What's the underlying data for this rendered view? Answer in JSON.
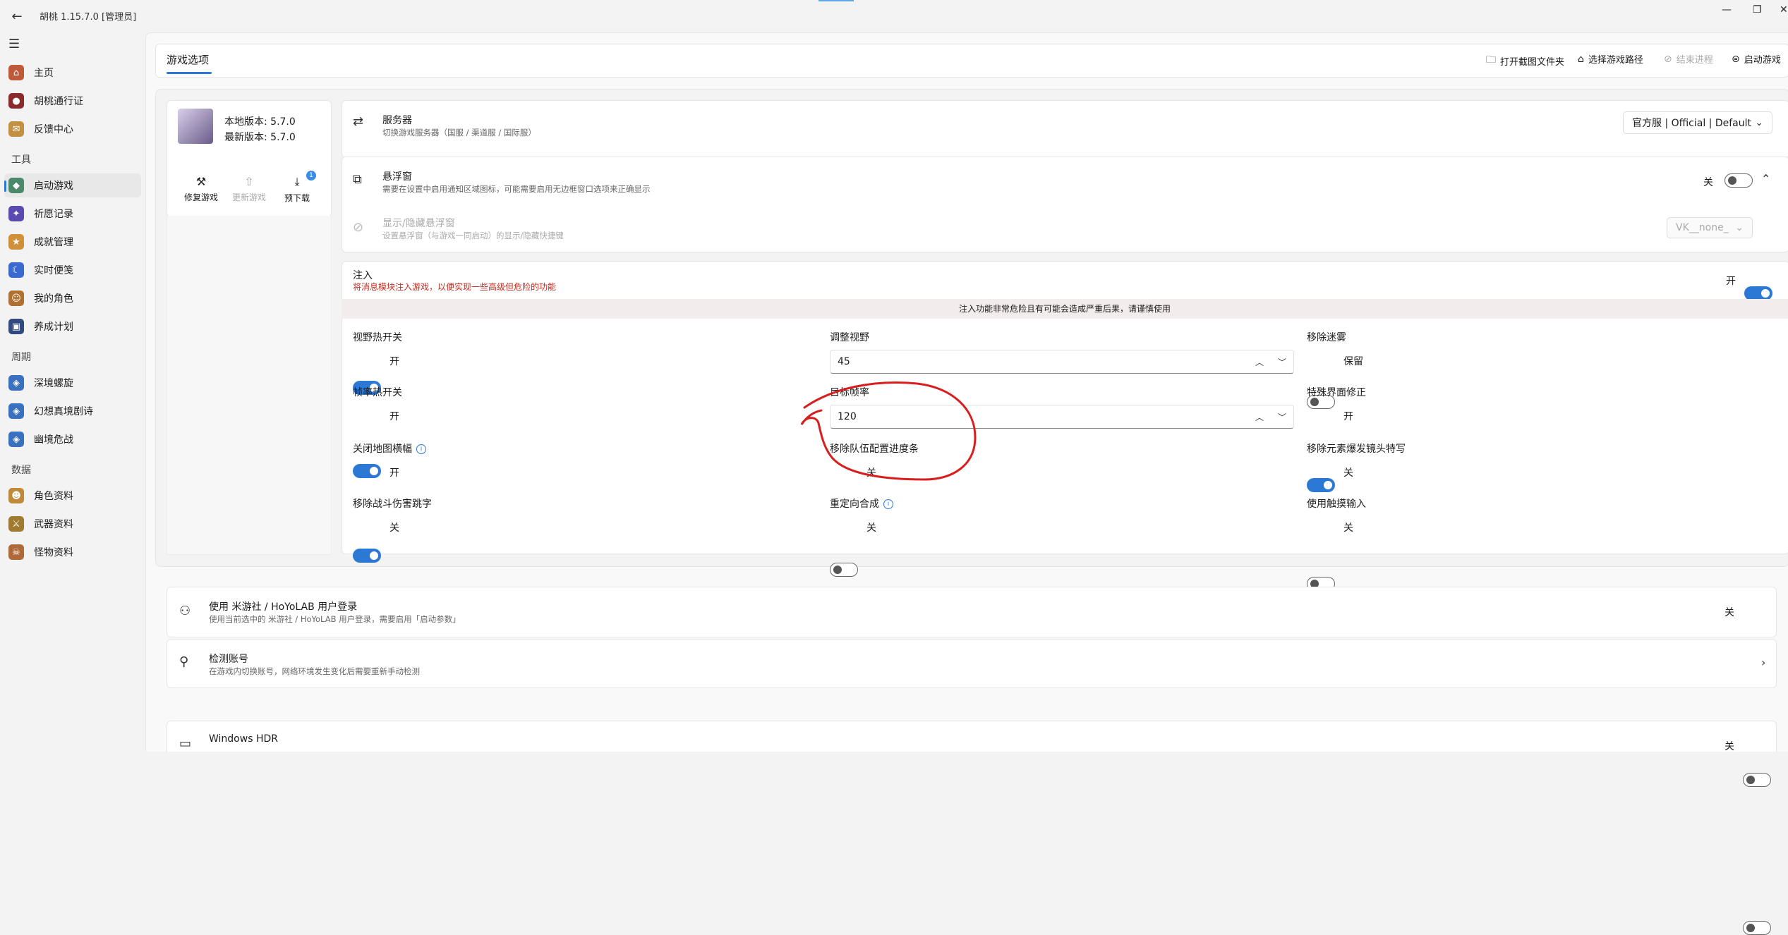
{
  "window": {
    "title": "胡桃 1.15.7.0 [管理员]"
  },
  "sidebar": {
    "items": [
      {
        "label": "主页",
        "icon": "home-icon",
        "color": "#c0593a"
      },
      {
        "label": "胡桃通行证",
        "icon": "passport-icon",
        "color": "#8b2a2a"
      },
      {
        "label": "反馈中心",
        "icon": "feedback-icon",
        "color": "#c29040"
      }
    ],
    "section_tools": "工具",
    "tool_items": [
      {
        "label": "启动游戏",
        "icon": "launch-game-icon",
        "color": "#4a8a6a",
        "active": true
      },
      {
        "label": "祈愿记录",
        "icon": "wish-record-icon",
        "color": "#5a4ab0"
      },
      {
        "label": "成就管理",
        "icon": "achievement-icon",
        "color": "#d0903a"
      },
      {
        "label": "实时便笺",
        "icon": "realtime-note-icon",
        "color": "#3a6ad0"
      },
      {
        "label": "我的角色",
        "icon": "my-character-icon",
        "color": "#b07030"
      },
      {
        "label": "养成计划",
        "icon": "cultivation-plan-icon",
        "color": "#304a80"
      }
    ],
    "section_cycle": "周期",
    "cycle_items": [
      {
        "label": "深境螺旋",
        "icon": "spiral-abyss-icon",
        "color": "#3a70c0"
      },
      {
        "label": "幻想真境剧诗",
        "icon": "theater-icon",
        "color": "#3a70c0"
      },
      {
        "label": "幽境危战",
        "icon": "stygian-icon",
        "color": "#3a70c0"
      }
    ],
    "section_data": "数据",
    "data_items": [
      {
        "label": "角色资料",
        "icon": "character-data-icon",
        "color": "#c08a3a"
      },
      {
        "label": "武器资料",
        "icon": "weapon-data-icon",
        "color": "#a07a30"
      },
      {
        "label": "怪物资料",
        "icon": "monster-data-icon",
        "color": "#b06a3a"
      }
    ]
  },
  "header": {
    "title": "游戏选项",
    "actions": {
      "open_screenshot": "打开截图文件夹",
      "choose_path": "选择游戏路径",
      "end_process": "结束进程",
      "launch": "启动游戏"
    }
  },
  "version": {
    "local": "本地版本: 5.7.0",
    "latest": "最新版本: 5.7.0",
    "repair": "修复游戏",
    "update": "更新游戏",
    "predownload": "预下载",
    "badge": "1"
  },
  "server": {
    "title": "服务器",
    "desc": "切换游戏服务器（国服 / 渠道服 / 国际服）",
    "value": "官方服 | Official | Default"
  },
  "floating": {
    "title": "悬浮窗",
    "desc": "需要在设置中启用通知区域图标，可能需要启用无边框窗口选项来正确显示",
    "state": "关",
    "hotkey_title": "显示/隐藏悬浮窗",
    "hotkey_desc": "设置悬浮窗（与游戏一同启动）的显示/隐藏快捷键",
    "hotkey_value": "VK__none_"
  },
  "injection": {
    "title": "注入",
    "desc": "将消息模块注入游戏，以便实现一些高级但危险的功能",
    "state": "开",
    "warning": "注入功能非常危险且有可能会造成严重后果，请谨慎使用",
    "cells": {
      "fov_toggle": {
        "title": "视野热开关",
        "state": "开"
      },
      "fov_adjust": {
        "title": "调整视野",
        "value": "45"
      },
      "remove_fog": {
        "title": "移除迷雾",
        "state": "保留"
      },
      "fps_toggle": {
        "title": "帧率热开关",
        "state": "开"
      },
      "target_fps": {
        "title": "目标帧率",
        "value": "120"
      },
      "special_ui": {
        "title": "特殊界面修正",
        "state": "开"
      },
      "close_map_banner": {
        "title": "关闭地图横幅",
        "state": "开"
      },
      "remove_team_progress": {
        "title": "移除队伍配置进度条",
        "state": "关"
      },
      "remove_burst_cam": {
        "title": "移除元素爆发镜头特写",
        "state": "关"
      },
      "remove_damage_text": {
        "title": "移除战斗伤害跳字",
        "state": "关"
      },
      "redirect_craft": {
        "title": "重定向合成",
        "state": "关"
      },
      "touch_input": {
        "title": "使用触摸输入",
        "state": "关"
      }
    }
  },
  "login": {
    "title": "使用 米游社 / HoYoLAB 用户登录",
    "desc": "使用当前选中的 米游社 / HoYoLAB 用户登录，需要启用「启动参数」",
    "state": "关"
  },
  "account_check": {
    "title": "检测账号",
    "desc": "在游戏内切换账号，网络环境发生变化后需要重新手动检测"
  },
  "hdr": {
    "title": "Windows HDR",
    "state": "关"
  },
  "colors": {
    "accent": "#2b79d4",
    "warning_text": "#c42b1c",
    "annotation": "#d81e1e"
  }
}
